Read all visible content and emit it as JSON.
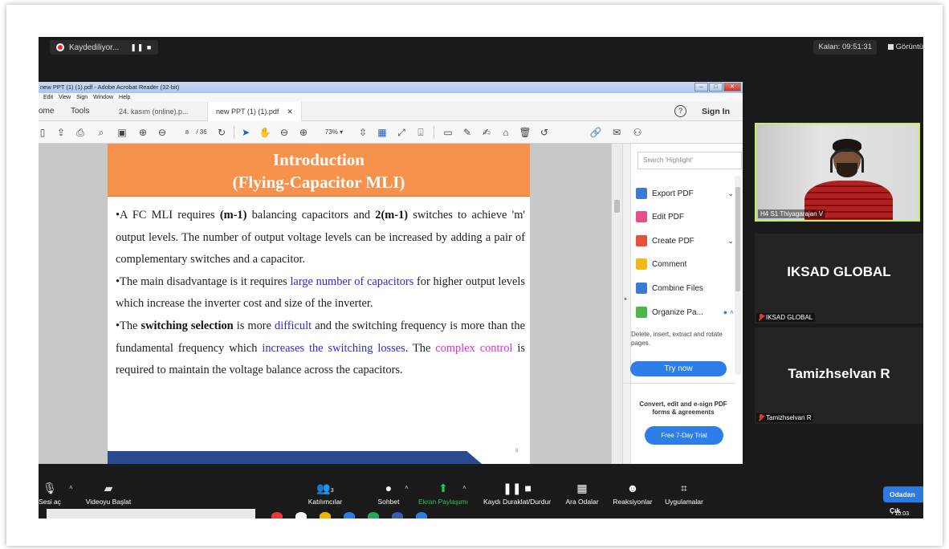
{
  "recording": {
    "label": "Kaydediliyor...",
    "controls": "❚❚  ■"
  },
  "timer": "Kalan: 09:51:31",
  "view_button": "Görüntü",
  "acrobat": {
    "title": "new PPT (1) (1).pdf - Adobe Acrobat Reader (32-bit)",
    "menu": [
      "Edit",
      "View",
      "Sign",
      "Window",
      "Help"
    ],
    "tabs": {
      "home": "ome",
      "tools": "Tools",
      "doc1": "24. kasım (online).p...",
      "doc2": "new PPT (1) (1).pdf"
    },
    "sign_in": "Sign In",
    "page_current": "8",
    "page_total": "/ 36",
    "zoom": "73%",
    "slide": {
      "title_line1": "Introduction",
      "title_line2": "(Flying-Capacitor MLI)",
      "p1_a": "•A FC MLI requires ",
      "p1_b": "(m-1)",
      "p1_c": " balancing capacitors and ",
      "p1_d": "2(m-1)",
      "p1_e": " switches to achieve 'm' output levels. The number of output voltage levels can be increased by adding a pair of complementary switches and a capacitor.",
      "p2_a": "•The main disadvantage is it requires ",
      "p2_b": "large number of capacitors",
      "p2_c": " for higher output levels which increase the inverter cost and size of the inverter.",
      "p3_a": "•The ",
      "p3_b": "switching selection",
      "p3_c": " is more ",
      "p3_d": "difficult",
      "p3_e": " and the switching frequency is more than the fundamental frequency which ",
      "p3_f": "increases the switching losses",
      "p3_g": ". The ",
      "p3_h": "complex control",
      "p3_i": " is required to maintain the voltage balance across the capacitors.",
      "page_number": "8"
    },
    "right_panel": {
      "search_placeholder": "Search 'Highlight'",
      "items": [
        "Export PDF",
        "Edit PDF",
        "Create PDF",
        "Comment",
        "Combine Files",
        "Organize Pa..."
      ],
      "description": "Delete, insert, extract and rotate pages.",
      "try_now": "Try now",
      "convert_text": "Convert, edit and e-sign PDF forms & agreements",
      "trial": "Free 7-Day Trial"
    }
  },
  "participants": [
    {
      "name": "H4 S1 Thiyagarajan V"
    },
    {
      "name": "IKSAD GLOBAL",
      "tag": "IKSAD GLOBAL"
    },
    {
      "name": "Tamizhselvan R",
      "tag": "Tamizhselvan R"
    }
  ],
  "toolbar": {
    "mute": "Sesi aç",
    "video": "Videoyu Başlat",
    "participants": "Katılımcılar",
    "participants_count": "3",
    "chat": "Sohbet",
    "share": "Ekran Paylaşımı",
    "pause_rec": "Kaydı Duraklat/Durdur",
    "rooms": "Ara Odalar",
    "reactions": "Reaksiyonlar",
    "apps": "Uygulamalar",
    "leave": "Odadan Çık",
    "clock": "10:03"
  },
  "colors": {
    "accent_green": "#c8ef5a",
    "zoom_blue": "#2d7be0",
    "share_green": "#26c85a",
    "slide_orange": "#f6924c"
  }
}
